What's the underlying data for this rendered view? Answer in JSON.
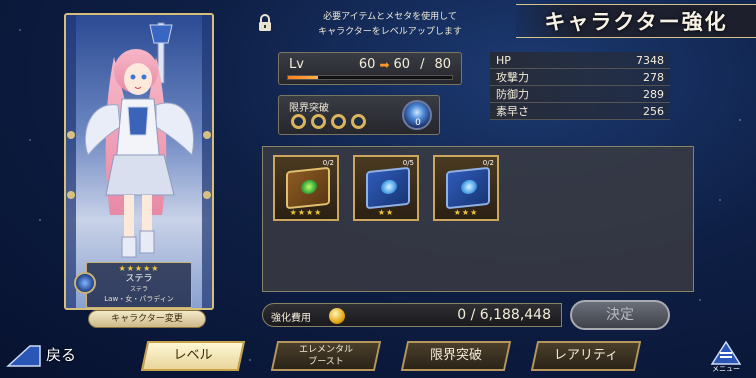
{
  "header": {
    "title": "キャラクター強化",
    "info_line1": "必要アイテムとメセタを使用して",
    "info_line2": "キャラクターをレベルアップします"
  },
  "card": {
    "stars": "★★★★★",
    "name": "ステラ",
    "sub": "ステラ",
    "class": "Law・女・パラディン",
    "change_button": "キャラクター変更"
  },
  "level": {
    "label": "Lv",
    "current": "60",
    "target": "60",
    "separator": "/",
    "max": "80",
    "progress": 0.18
  },
  "limit_break": {
    "label": "限界突破",
    "orb_count": "0"
  },
  "stats": [
    {
      "label": "HP",
      "value": "7348"
    },
    {
      "label": "攻撃力",
      "value": "278"
    },
    {
      "label": "防御力",
      "value": "289"
    },
    {
      "label": "素早さ",
      "value": "256"
    }
  ],
  "items": [
    {
      "count": "0/2",
      "stars": "★★★★",
      "type": "gold-book"
    },
    {
      "count": "0/5",
      "stars": "★★",
      "type": "blue-book"
    },
    {
      "count": "0/2",
      "stars": "★★★",
      "type": "blue-book"
    }
  ],
  "cost": {
    "label": "強化費用",
    "value": "0 / 6,188,448"
  },
  "confirm_button": "決定",
  "back_button": "戻る",
  "tabs": [
    {
      "label": "レベル",
      "active": true
    },
    {
      "label": "エレメンタル",
      "label2": "ブースト",
      "active": false
    },
    {
      "label": "限界突破",
      "active": false
    },
    {
      "label": "レアリティ",
      "active": false
    }
  ],
  "menu_label": "メニュー",
  "colors": {
    "accent_gold": "#d6bf7b",
    "progress_orange": "#ff9a2e",
    "star_yellow": "#f1c93b"
  }
}
